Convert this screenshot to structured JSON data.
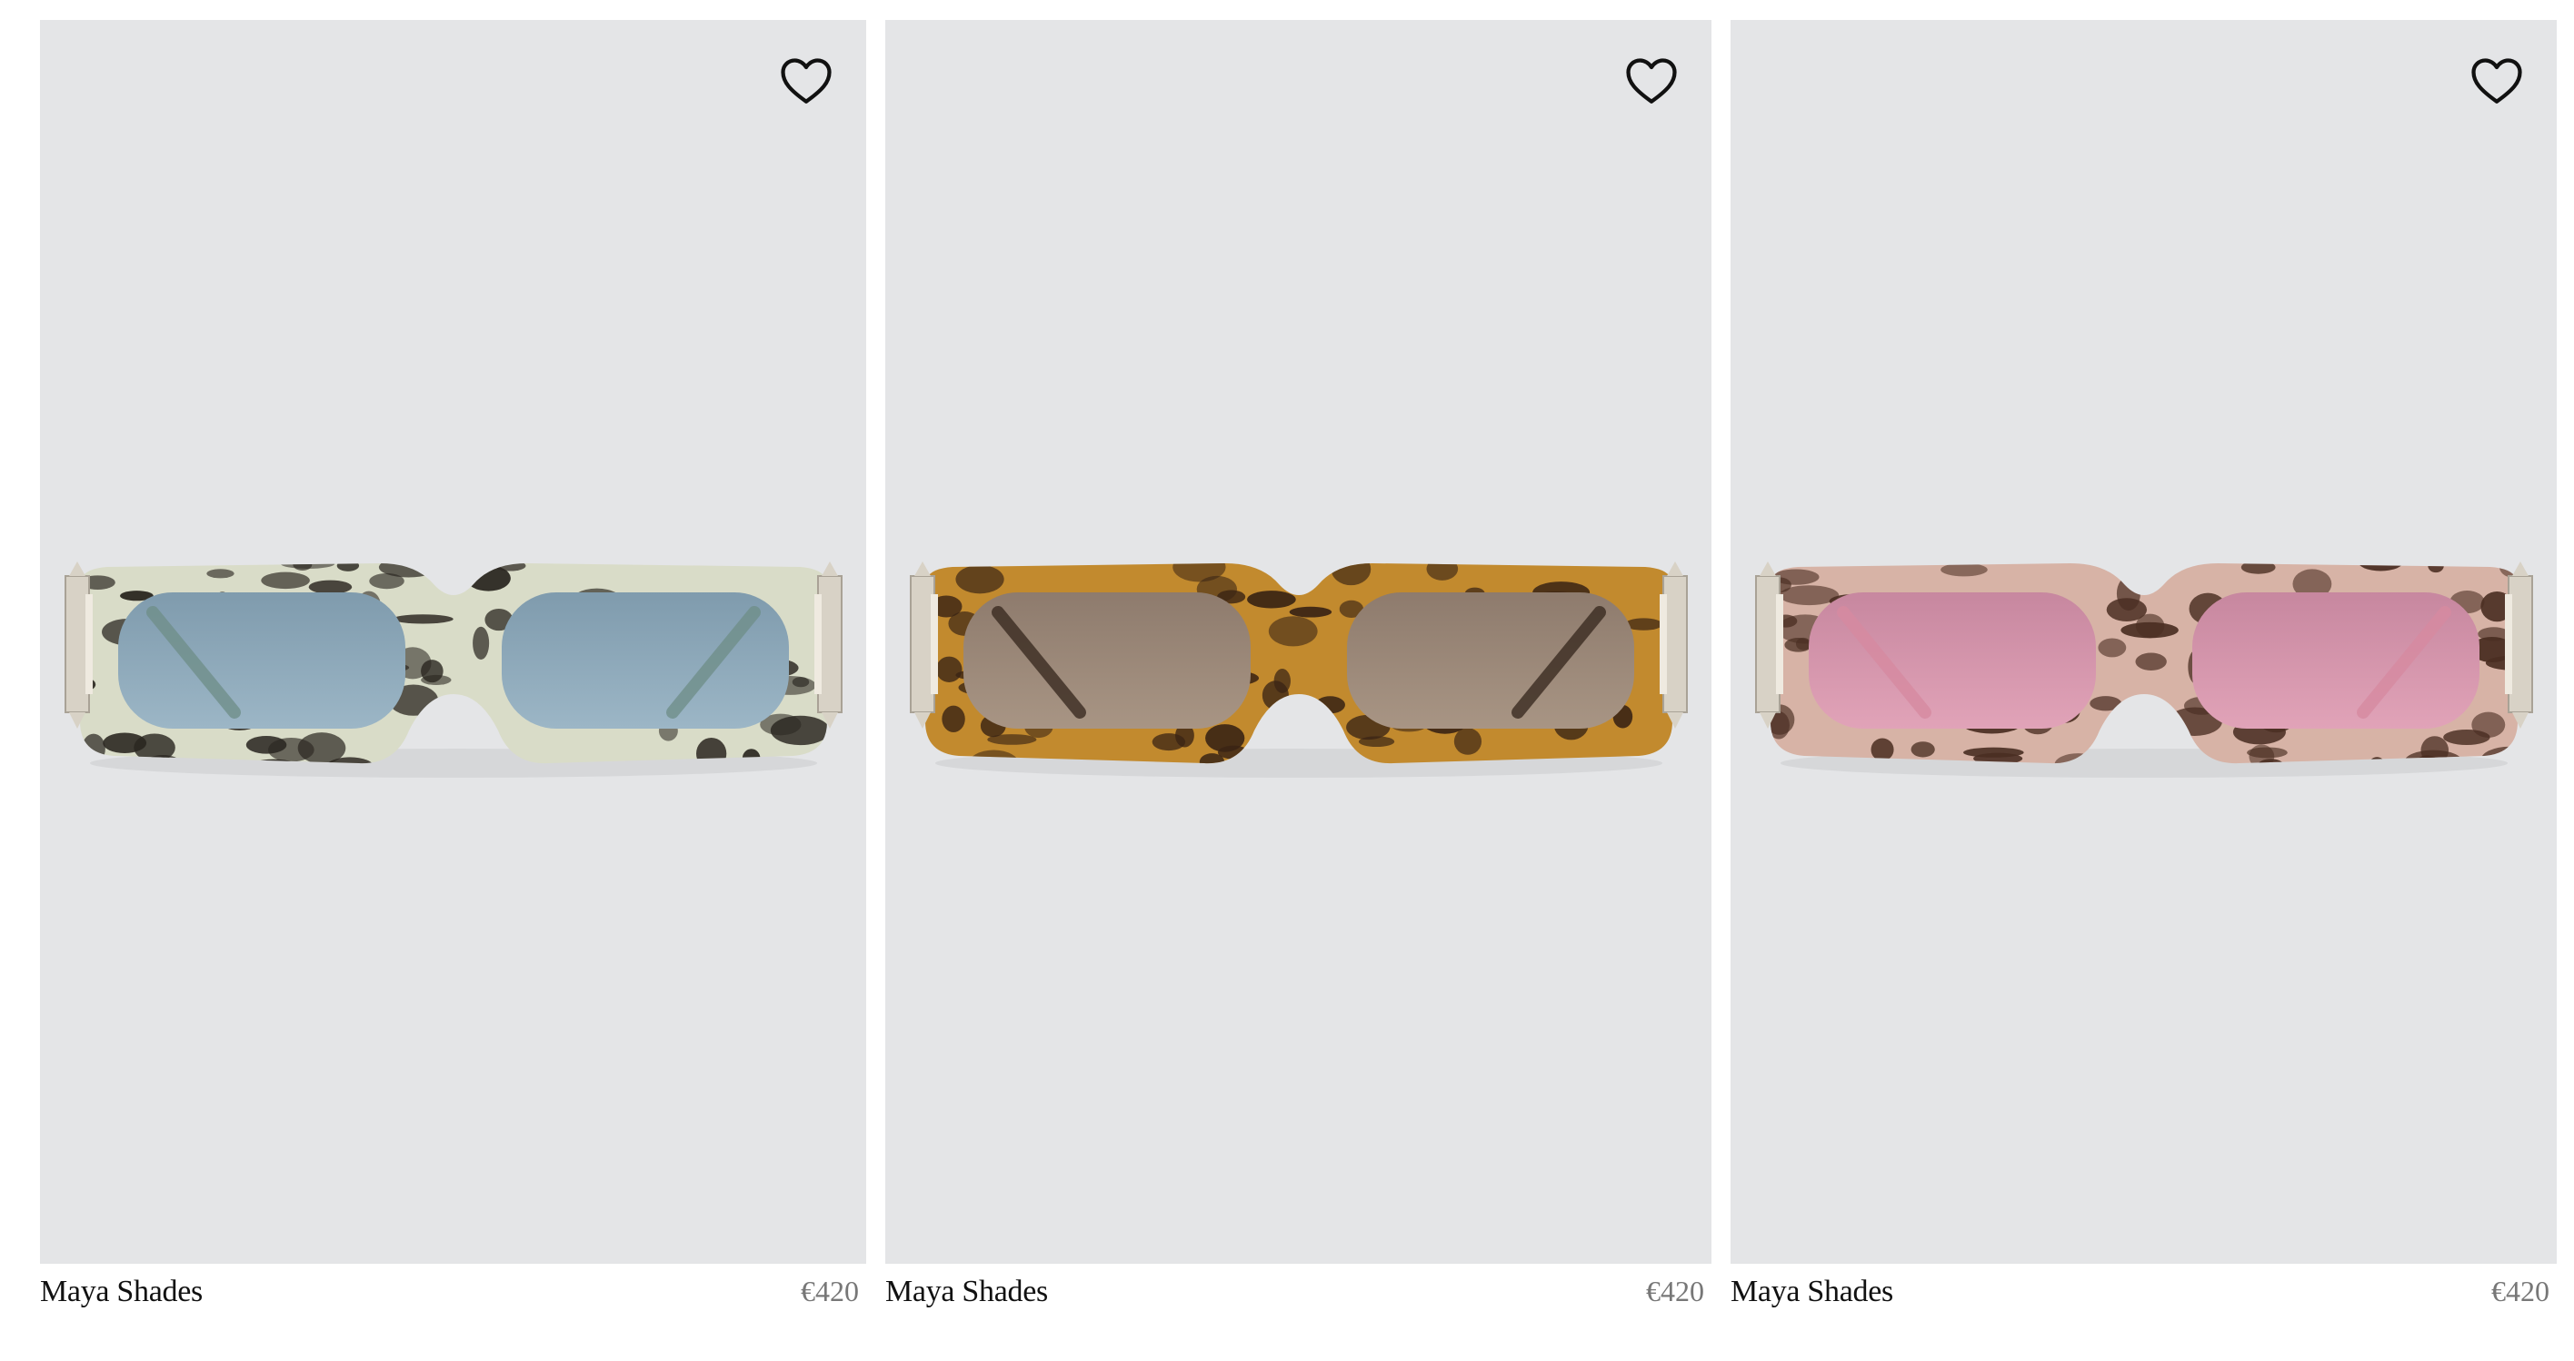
{
  "products": [
    {
      "name": "Maya Shades",
      "price": "€420",
      "favorite_icon": "heart-outline-icon",
      "frame": {
        "base": "#d9dcc8",
        "spot": "#2a2620",
        "lens": "#9cb6c6",
        "lens_dark": "#7f9bad",
        "temple": "#6f8e8a"
      }
    },
    {
      "name": "Maya Shades",
      "price": "€420",
      "favorite_icon": "heart-outline-icon",
      "frame": {
        "base": "#c28a2e",
        "spot": "#3a2414",
        "lens": "#a89584",
        "lens_dark": "#8e7b6d",
        "temple": "#3a2a20"
      }
    },
    {
      "name": "Maya Shades",
      "price": "€420",
      "favorite_icon": "heart-outline-icon",
      "frame": {
        "base": "#d7b3a6",
        "spot": "#4a2e22",
        "lens": "#e1a3b8",
        "lens_dark": "#c7879f",
        "temple": "#d68aa0"
      }
    }
  ],
  "colors": {
    "card_background": "#e4e5e7",
    "metal_hinge": "#d8d2c6"
  }
}
